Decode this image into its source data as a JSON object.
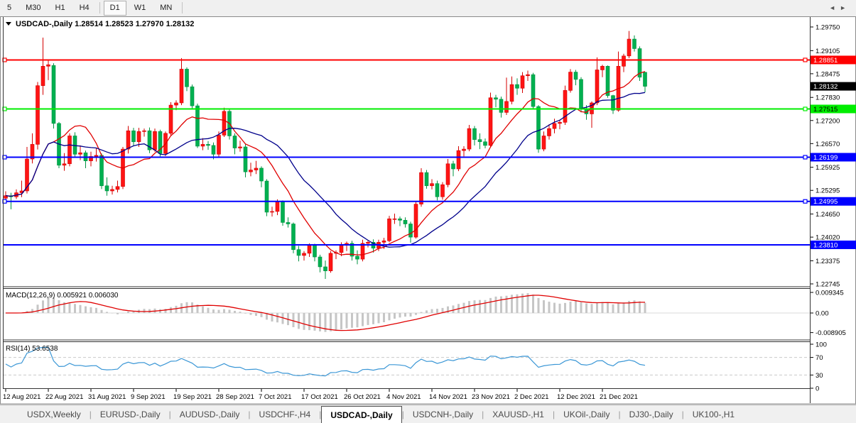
{
  "toolbar": {
    "items": [
      {
        "type": "button",
        "label": "5"
      },
      {
        "type": "button",
        "label": "M30"
      },
      {
        "type": "button",
        "label": "H1"
      },
      {
        "type": "button",
        "label": "H4"
      },
      {
        "type": "sep"
      },
      {
        "type": "button",
        "label": "D1",
        "active": true
      },
      {
        "type": "button",
        "label": "W1"
      },
      {
        "type": "button",
        "label": "MN"
      },
      {
        "type": "sep"
      }
    ]
  },
  "chart": {
    "title": {
      "marker": "▼",
      "symbol_label": "USDCAD-,Daily",
      "open": "1.28514",
      "high": "1.28523",
      "low": "1.27970",
      "close": "1.28132"
    }
  },
  "chart_data": {
    "type": "candlestick",
    "symbol": "USDCAD-,Daily",
    "price_axis": {
      "min": 1.22745,
      "max": 1.2975,
      "ticks": [
        "1.29750",
        "1.29105",
        "1.28475",
        "1.27830",
        "1.27200",
        "1.26570",
        "1.25925",
        "1.25295",
        "1.24650",
        "1.24020",
        "1.23375",
        "1.22745"
      ]
    },
    "price_badges": [
      {
        "value": "1.28851",
        "price": 1.28851,
        "bg": "#ff0000",
        "fg": "#ffffff"
      },
      {
        "value": "1.28132",
        "price": 1.28132,
        "bg": "#000000",
        "fg": "#ffffff"
      },
      {
        "value": "1.27515",
        "price": 1.27515,
        "bg": "#00ee00",
        "fg": "#000000"
      },
      {
        "value": "1.26199",
        "price": 1.26199,
        "bg": "#0000ff",
        "fg": "#ffffff"
      },
      {
        "value": "1.24995",
        "price": 1.24995,
        "bg": "#0000ff",
        "fg": "#ffffff"
      },
      {
        "value": "1.23810",
        "price": 1.2381,
        "bg": "#0000ff",
        "fg": "#ffffff"
      }
    ],
    "hlines": [
      {
        "price": 1.28851,
        "color": "#ff0000",
        "selected": true
      },
      {
        "price": 1.27515,
        "color": "#00ee00",
        "selected": true
      },
      {
        "price": 1.26199,
        "color": "#0000ff",
        "selected": true
      },
      {
        "price": 1.24995,
        "color": "#0000ff",
        "selected": true
      },
      {
        "price": 1.2381,
        "color": "#0000ff",
        "selected": false
      }
    ],
    "x_axis_dates": [
      {
        "label": "12 Aug 2021",
        "bar": 0
      },
      {
        "label": "22 Aug 2021",
        "bar": 8
      },
      {
        "label": "31 Aug 2021",
        "bar": 16
      },
      {
        "label": "9 Sep 2021",
        "bar": 24
      },
      {
        "label": "19 Sep 2021",
        "bar": 32
      },
      {
        "label": "28 Sep 2021",
        "bar": 40
      },
      {
        "label": "7 Oct 2021",
        "bar": 48
      },
      {
        "label": "17 Oct 2021",
        "bar": 56
      },
      {
        "label": "26 Oct 2021",
        "bar": 64
      },
      {
        "label": "4 Nov 2021",
        "bar": 72
      },
      {
        "label": "14 Nov 2021",
        "bar": 80
      },
      {
        "label": "23 Nov 2021",
        "bar": 88
      },
      {
        "label": "2 Dec 2021",
        "bar": 96
      },
      {
        "label": "12 Dec 2021",
        "bar": 104
      },
      {
        "label": "21 Dec 2021",
        "bar": 112
      }
    ],
    "candles": [
      [
        1.2508,
        1.2527,
        1.2495,
        1.2515
      ],
      [
        1.2515,
        1.2523,
        1.2478,
        1.2512
      ],
      [
        1.2512,
        1.2532,
        1.2506,
        1.2523
      ],
      [
        1.2523,
        1.2556,
        1.2511,
        1.2528
      ],
      [
        1.2528,
        1.2648,
        1.2521,
        1.2615
      ],
      [
        1.2615,
        1.2685,
        1.2603,
        1.2655
      ],
      [
        1.2655,
        1.2825,
        1.2641,
        1.2815
      ],
      [
        1.2815,
        1.2946,
        1.279,
        1.2868
      ],
      [
        1.2868,
        1.2884,
        1.283,
        1.2872
      ],
      [
        1.287,
        1.2876,
        1.2698,
        1.2712
      ],
      [
        1.2712,
        1.2716,
        1.259,
        1.2598
      ],
      [
        1.2598,
        1.2631,
        1.2583,
        1.2602
      ],
      [
        1.2602,
        1.2685,
        1.2595,
        1.2678
      ],
      [
        1.2678,
        1.2688,
        1.2618,
        1.2628
      ],
      [
        1.2628,
        1.2652,
        1.2612,
        1.2632
      ],
      [
        1.2632,
        1.2638,
        1.259,
        1.261
      ],
      [
        1.261,
        1.2635,
        1.2595,
        1.2622
      ],
      [
        1.2622,
        1.2644,
        1.2608,
        1.2625
      ],
      [
        1.2625,
        1.263,
        1.2533,
        1.2542
      ],
      [
        1.2542,
        1.2565,
        1.2515,
        1.2528
      ],
      [
        1.2528,
        1.2542,
        1.2518,
        1.2532
      ],
      [
        1.2532,
        1.2556,
        1.2524,
        1.254
      ],
      [
        1.254,
        1.2648,
        1.2533,
        1.2642
      ],
      [
        1.2642,
        1.2705,
        1.263,
        1.2692
      ],
      [
        1.2692,
        1.27,
        1.2651,
        1.2662
      ],
      [
        1.2662,
        1.27,
        1.2648,
        1.269
      ],
      [
        1.269,
        1.2698,
        1.2676,
        1.2692
      ],
      [
        1.2692,
        1.2701,
        1.2631,
        1.264
      ],
      [
        1.264,
        1.2698,
        1.2635,
        1.269
      ],
      [
        1.269,
        1.2695,
        1.2622,
        1.263
      ],
      [
        1.263,
        1.269,
        1.2623,
        1.2685
      ],
      [
        1.2685,
        1.277,
        1.268,
        1.2762
      ],
      [
        1.2762,
        1.2775,
        1.2748,
        1.2768
      ],
      [
        1.2768,
        1.289,
        1.2762,
        1.286
      ],
      [
        1.286,
        1.2865,
        1.28,
        1.2812
      ],
      [
        1.2812,
        1.2818,
        1.275,
        1.276
      ],
      [
        1.276,
        1.2766,
        1.2645,
        1.265
      ],
      [
        1.265,
        1.2672,
        1.2639,
        1.2655
      ],
      [
        1.2655,
        1.2664,
        1.264,
        1.2652
      ],
      [
        1.2652,
        1.266,
        1.2614,
        1.2628
      ],
      [
        1.2628,
        1.269,
        1.262,
        1.268
      ],
      [
        1.268,
        1.2755,
        1.2675,
        1.2745
      ],
      [
        1.2745,
        1.275,
        1.2668,
        1.2678
      ],
      [
        1.2678,
        1.2685,
        1.2628,
        1.2645
      ],
      [
        1.2645,
        1.2665,
        1.2635,
        1.2648
      ],
      [
        1.2648,
        1.2655,
        1.2565,
        1.258
      ],
      [
        1.258,
        1.2605,
        1.2568,
        1.2585
      ],
      [
        1.2585,
        1.261,
        1.2574,
        1.259
      ],
      [
        1.259,
        1.2595,
        1.2538,
        1.2555
      ],
      [
        1.2555,
        1.256,
        1.2459,
        1.247
      ],
      [
        1.247,
        1.2485,
        1.2458,
        1.2472
      ],
      [
        1.2472,
        1.2505,
        1.2462,
        1.2498
      ],
      [
        1.2498,
        1.2502,
        1.2433,
        1.2442
      ],
      [
        1.2442,
        1.2456,
        1.2428,
        1.2438
      ],
      [
        1.2438,
        1.2442,
        1.2358,
        1.2368
      ],
      [
        1.2368,
        1.2378,
        1.2336,
        1.2352
      ],
      [
        1.2352,
        1.2364,
        1.2338,
        1.2358
      ],
      [
        1.2358,
        1.2385,
        1.2348,
        1.238
      ],
      [
        1.238,
        1.2384,
        1.2336,
        1.2348
      ],
      [
        1.2348,
        1.2354,
        1.2306,
        1.2321
      ],
      [
        1.2321,
        1.2338,
        1.2288,
        1.231
      ],
      [
        1.231,
        1.2364,
        1.2305,
        1.2358
      ],
      [
        1.2358,
        1.2366,
        1.2342,
        1.236
      ],
      [
        1.236,
        1.2388,
        1.235,
        1.2382
      ],
      [
        1.2382,
        1.239,
        1.2364,
        1.2385
      ],
      [
        1.2385,
        1.2392,
        1.2338,
        1.235
      ],
      [
        1.235,
        1.2366,
        1.2328,
        1.2342
      ],
      [
        1.2342,
        1.2395,
        1.2336,
        1.2385
      ],
      [
        1.2385,
        1.2392,
        1.2374,
        1.2388
      ],
      [
        1.2388,
        1.2396,
        1.236,
        1.2372
      ],
      [
        1.2372,
        1.2395,
        1.2364,
        1.2388
      ],
      [
        1.2388,
        1.24,
        1.237,
        1.2392
      ],
      [
        1.2392,
        1.246,
        1.2388,
        1.2452
      ],
      [
        1.2452,
        1.2466,
        1.2438,
        1.2452
      ],
      [
        1.2452,
        1.2458,
        1.2432,
        1.2448
      ],
      [
        1.2448,
        1.2456,
        1.2428,
        1.2438
      ],
      [
        1.2438,
        1.2444,
        1.2387,
        1.2402
      ],
      [
        1.2402,
        1.25,
        1.2398,
        1.2492
      ],
      [
        1.2492,
        1.259,
        1.2485,
        1.2578
      ],
      [
        1.2578,
        1.2585,
        1.2534,
        1.2542
      ],
      [
        1.2542,
        1.256,
        1.2532,
        1.2548
      ],
      [
        1.2548,
        1.2556,
        1.2502,
        1.2512
      ],
      [
        1.2512,
        1.2552,
        1.2504,
        1.2545
      ],
      [
        1.2545,
        1.2615,
        1.2538,
        1.2602
      ],
      [
        1.2602,
        1.261,
        1.2568,
        1.2588
      ],
      [
        1.2588,
        1.265,
        1.2582,
        1.2638
      ],
      [
        1.2638,
        1.265,
        1.2622,
        1.2642
      ],
      [
        1.2642,
        1.2708,
        1.2636,
        1.2698
      ],
      [
        1.2698,
        1.2705,
        1.2652,
        1.2668
      ],
      [
        1.2668,
        1.2685,
        1.2642,
        1.2662
      ],
      [
        1.2662,
        1.2671,
        1.2644,
        1.2652
      ],
      [
        1.2652,
        1.2796,
        1.2648,
        1.2782
      ],
      [
        1.2782,
        1.279,
        1.2756,
        1.2778
      ],
      [
        1.2778,
        1.2785,
        1.2728,
        1.2742
      ],
      [
        1.2742,
        1.2837,
        1.2735,
        1.2772
      ],
      [
        1.2772,
        1.284,
        1.2764,
        1.2818
      ],
      [
        1.2818,
        1.2835,
        1.279,
        1.2808
      ],
      [
        1.2808,
        1.2852,
        1.2795,
        1.2842
      ],
      [
        1.2842,
        1.2856,
        1.2828,
        1.2845
      ],
      [
        1.2845,
        1.285,
        1.275,
        1.2758
      ],
      [
        1.2758,
        1.2762,
        1.2632,
        1.2642
      ],
      [
        1.2642,
        1.269,
        1.2636,
        1.2678
      ],
      [
        1.2678,
        1.271,
        1.2668,
        1.2698
      ],
      [
        1.2698,
        1.2725,
        1.2685,
        1.2712
      ],
      [
        1.2712,
        1.2722,
        1.2696,
        1.2715
      ],
      [
        1.2715,
        1.2815,
        1.2708,
        1.2802
      ],
      [
        1.2802,
        1.286,
        1.2796,
        1.2852
      ],
      [
        1.2852,
        1.2858,
        1.2816,
        1.2832
      ],
      [
        1.2832,
        1.2838,
        1.2742,
        1.2752
      ],
      [
        1.2752,
        1.2762,
        1.2722,
        1.2738
      ],
      [
        1.2738,
        1.2772,
        1.27,
        1.2768
      ],
      [
        1.2768,
        1.2892,
        1.2762,
        1.2858
      ],
      [
        1.2858,
        1.2872,
        1.2838,
        1.2868
      ],
      [
        1.2868,
        1.287,
        1.2782,
        1.2788
      ],
      [
        1.2788,
        1.279,
        1.2738,
        1.2748
      ],
      [
        1.2748,
        1.2908,
        1.2744,
        1.2868
      ],
      [
        1.2868,
        1.2902,
        1.2852,
        1.2896
      ],
      [
        1.2896,
        1.2964,
        1.289,
        1.2942
      ],
      [
        1.2942,
        1.2952,
        1.2908,
        1.2916
      ],
      [
        1.2916,
        1.2922,
        1.2828,
        1.2838
      ],
      [
        1.28514,
        1.28523,
        1.2797,
        1.28132
      ]
    ],
    "moving_averages": [
      {
        "name": "ma-fast",
        "period": 10,
        "color": "#e00000"
      },
      {
        "name": "ma-slow",
        "period": 21,
        "color": "#00008b"
      }
    ],
    "indicators": {
      "macd": {
        "label": "MACD(12,26,9)",
        "value": "0.005921",
        "signal_value": "0.006030",
        "fast": 12,
        "slow": 26,
        "signal": 9,
        "axis_labels": [
          "0.009345",
          "0.00",
          "-0.008905"
        ],
        "axis_max": 0.009345,
        "axis_min": -0.008905,
        "histogram_color": "#c6c6c6",
        "signal_color": "#e00000"
      },
      "rsi": {
        "label": "RSI(14)",
        "value": "53.6538",
        "period": 14,
        "current": 53.6538,
        "levels": [
          70,
          30
        ],
        "axis_labels": [
          "100",
          "70",
          "30",
          "0"
        ],
        "line_color": "#3b97d6"
      }
    },
    "colors": {
      "bull": "#ff1414",
      "bull_border": "#d40000",
      "bear": "#00b050",
      "bear_border": "#009342",
      "background": "#ffffff",
      "frame": "#333333",
      "axis_text": "#000000",
      "level_dash": "#c9c9c9"
    }
  },
  "tabbar": {
    "tabs": [
      {
        "label": "USDX,Weekly"
      },
      {
        "label": "EURUSD-,Daily"
      },
      {
        "label": "AUDUSD-,Daily"
      },
      {
        "label": "USDCHF-,H4"
      },
      {
        "label": "USDCAD-,Daily",
        "active": true
      },
      {
        "label": "USDCNH-,Daily"
      },
      {
        "label": "XAUUSD-,H1"
      },
      {
        "label": "UKOil-,Daily"
      },
      {
        "label": "DJ30-,Daily"
      },
      {
        "label": "UK100-,H1"
      }
    ],
    "separator": "|",
    "scroll_left": "◄",
    "scroll_right": "►"
  }
}
